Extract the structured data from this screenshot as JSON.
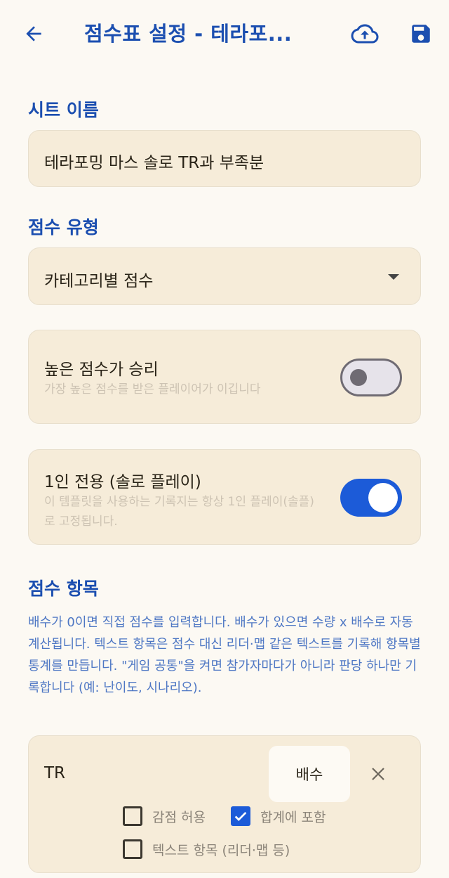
{
  "header": {
    "title": "점수표 설정 - 테라포..."
  },
  "sheet_name": {
    "label": "시트 이름",
    "value": "테라포밍 마스 솔로 TR과 부족분"
  },
  "score_type": {
    "label": "점수 유형",
    "selected": "카테고리별 점수"
  },
  "high_score_wins": {
    "title": "높은 점수가 승리",
    "description": "가장 높은 점수를 받은 플레이어가 이깁니다",
    "enabled": false
  },
  "solo_only": {
    "title": "1인 전용 (솔로 플레이)",
    "description": "이 템플릿을 사용하는 기록지는 항상 1인 플레이(솔플)로 고정됩니다.",
    "enabled": true
  },
  "score_items": {
    "label": "점수 항목",
    "help": "배수가 0이면 직접 점수를 입력합니다. 배수가 있으면 수량 x 배수로 자동 계산됩니다. 텍스트 항목은 점수 대신 리더·맵 같은 텍스트를 기록해 항목별 통계를 만듭니다. \"게임 공통\"을 켜면 참가자마다가 아니라 판당 하나만 기록합니다 (예: 난이도, 시나리오).",
    "items": [
      {
        "name": "TR",
        "multiplier_placeholder": "배수",
        "allow_negative": {
          "label": "감점 허용",
          "checked": false
        },
        "include_in_total": {
          "label": "합계에 포함",
          "checked": true
        },
        "text_item": {
          "label": "텍스트 항목 (리더·맵 등)",
          "checked": false
        }
      }
    ]
  },
  "colors": {
    "accent": "#1c4fb0",
    "switch_on": "#1c5bd8",
    "card_bg": "#f6ecd9",
    "page_bg": "#fcf9f3"
  }
}
